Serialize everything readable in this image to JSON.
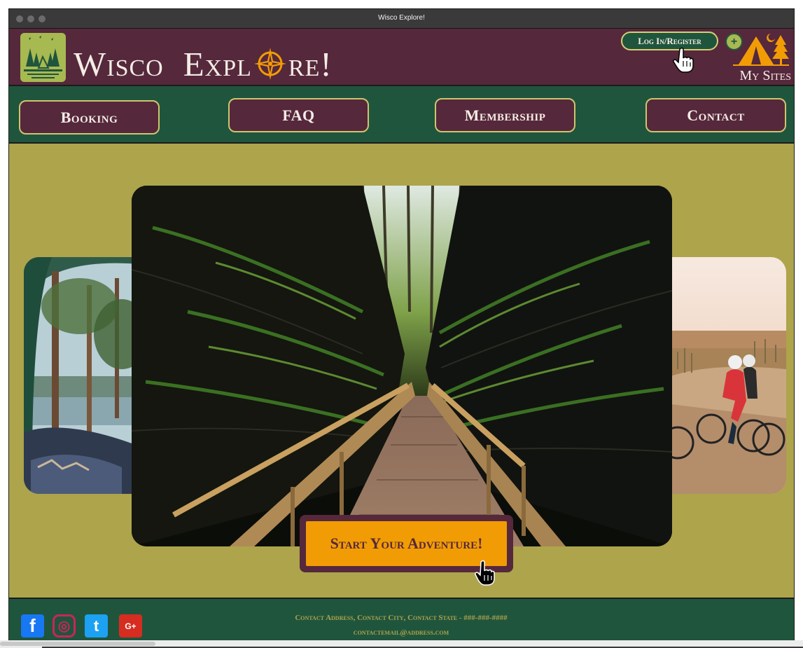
{
  "window": {
    "title": "Wisco Explore!"
  },
  "header": {
    "brand_word_1": "Wisco",
    "brand_word_2_start": "Expl",
    "brand_word_2_end": "re!",
    "login_label": "Log In/Register",
    "plus_label": "+",
    "my_sites_label": "My Sites"
  },
  "nav": {
    "items": [
      {
        "label": "Booking"
      },
      {
        "label": "FAQ"
      },
      {
        "label": "Membership"
      },
      {
        "label": "Contact"
      }
    ]
  },
  "hero": {
    "cta_label": "Start Your Adventure!"
  },
  "footer": {
    "address_line": "Contact Address, Contact City, Contact State - ###-###-####",
    "email_line": "contactemail@address.com",
    "social": [
      {
        "icon": "facebook-icon",
        "glyph": "f",
        "color": "#1877f2"
      },
      {
        "icon": "instagram-icon",
        "glyph": "◎",
        "color": "#c8265a"
      },
      {
        "icon": "twitter-icon",
        "glyph": "t",
        "color": "#1da1f2"
      },
      {
        "icon": "google-plus-icon",
        "glyph": "G+",
        "color": "#d62d20"
      }
    ]
  },
  "colors": {
    "maroon": "#56283b",
    "forest_green": "#20553d",
    "olive_gold": "#ada44c",
    "orange": "#f29c05",
    "cream": "#f3ede6"
  }
}
